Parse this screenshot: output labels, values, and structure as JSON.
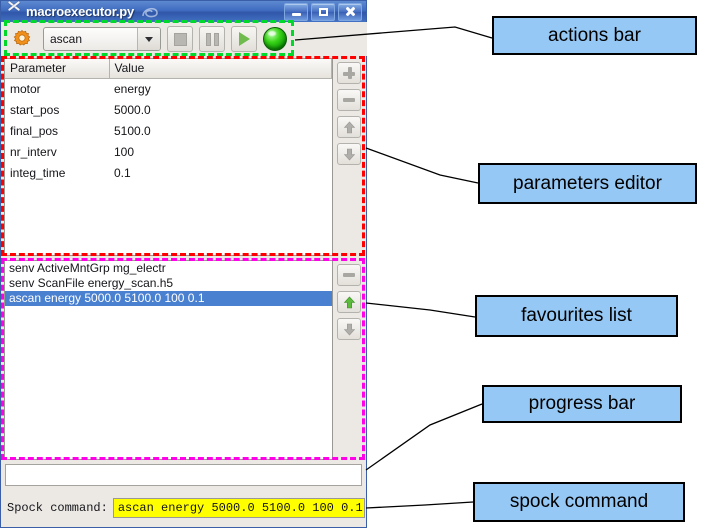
{
  "window": {
    "title": "macroexecutor.py",
    "app_icon": "scissors-icon",
    "shell_icon": "shell-icon",
    "buttons": {
      "minimize": "minimize-button",
      "maximize": "maximize-button",
      "close": "close-button"
    }
  },
  "actions_bar": {
    "settings_icon": "gear-icon",
    "macro_combo": {
      "value": "ascan",
      "options": [
        "ascan"
      ]
    },
    "stop_button": "stop-icon",
    "pause_button": "pause-icon",
    "play_button": "play-icon",
    "status_led": {
      "name": "status-led",
      "color": "#39d417",
      "state": "on"
    }
  },
  "parameters_editor": {
    "columns": [
      "Parameter",
      "Value"
    ],
    "rows": [
      {
        "parameter": "motor",
        "value": "energy"
      },
      {
        "parameter": "start_pos",
        "value": "5000.0"
      },
      {
        "parameter": "final_pos",
        "value": "5100.0"
      },
      {
        "parameter": "nr_interv",
        "value": "100"
      },
      {
        "parameter": "integ_time",
        "value": "0.1"
      }
    ],
    "side_buttons": [
      "plus-icon",
      "minus-icon",
      "arrow-up-icon",
      "arrow-down-icon"
    ]
  },
  "favourites_list": {
    "items": [
      {
        "text": "senv ActiveMntGrp mg_electr",
        "selected": false
      },
      {
        "text": "senv ScanFile energy_scan.h5",
        "selected": false
      },
      {
        "text": "ascan energy 5000.0 5100.0 100 0.1",
        "selected": true
      }
    ],
    "side_buttons": [
      "minus-icon",
      "arrow-up-icon",
      "arrow-down-icon"
    ],
    "selection_color": "#4a80d0",
    "up_arrow_color": "#5cbb3c"
  },
  "progress_bar": {
    "value": "",
    "percent": 0
  },
  "spock_command": {
    "label": "Spock command:",
    "value": "ascan energy 5000.0 5100.0 100 0.1",
    "field_background": "#ffff00"
  },
  "annotations": {
    "callouts": [
      {
        "id": "actions",
        "label": "actions bar"
      },
      {
        "id": "params",
        "label": "parameters editor"
      },
      {
        "id": "fav",
        "label": "favourites list"
      },
      {
        "id": "progress",
        "label": "progress bar"
      },
      {
        "id": "spock",
        "label": "spock command"
      }
    ],
    "box_fill": "#96c8f5",
    "box_border": "#000000",
    "dash_colors": {
      "actions_bar": "#00d92b",
      "parameters_editor": "#ff0000",
      "favourites_list": "#ff00e8"
    }
  }
}
